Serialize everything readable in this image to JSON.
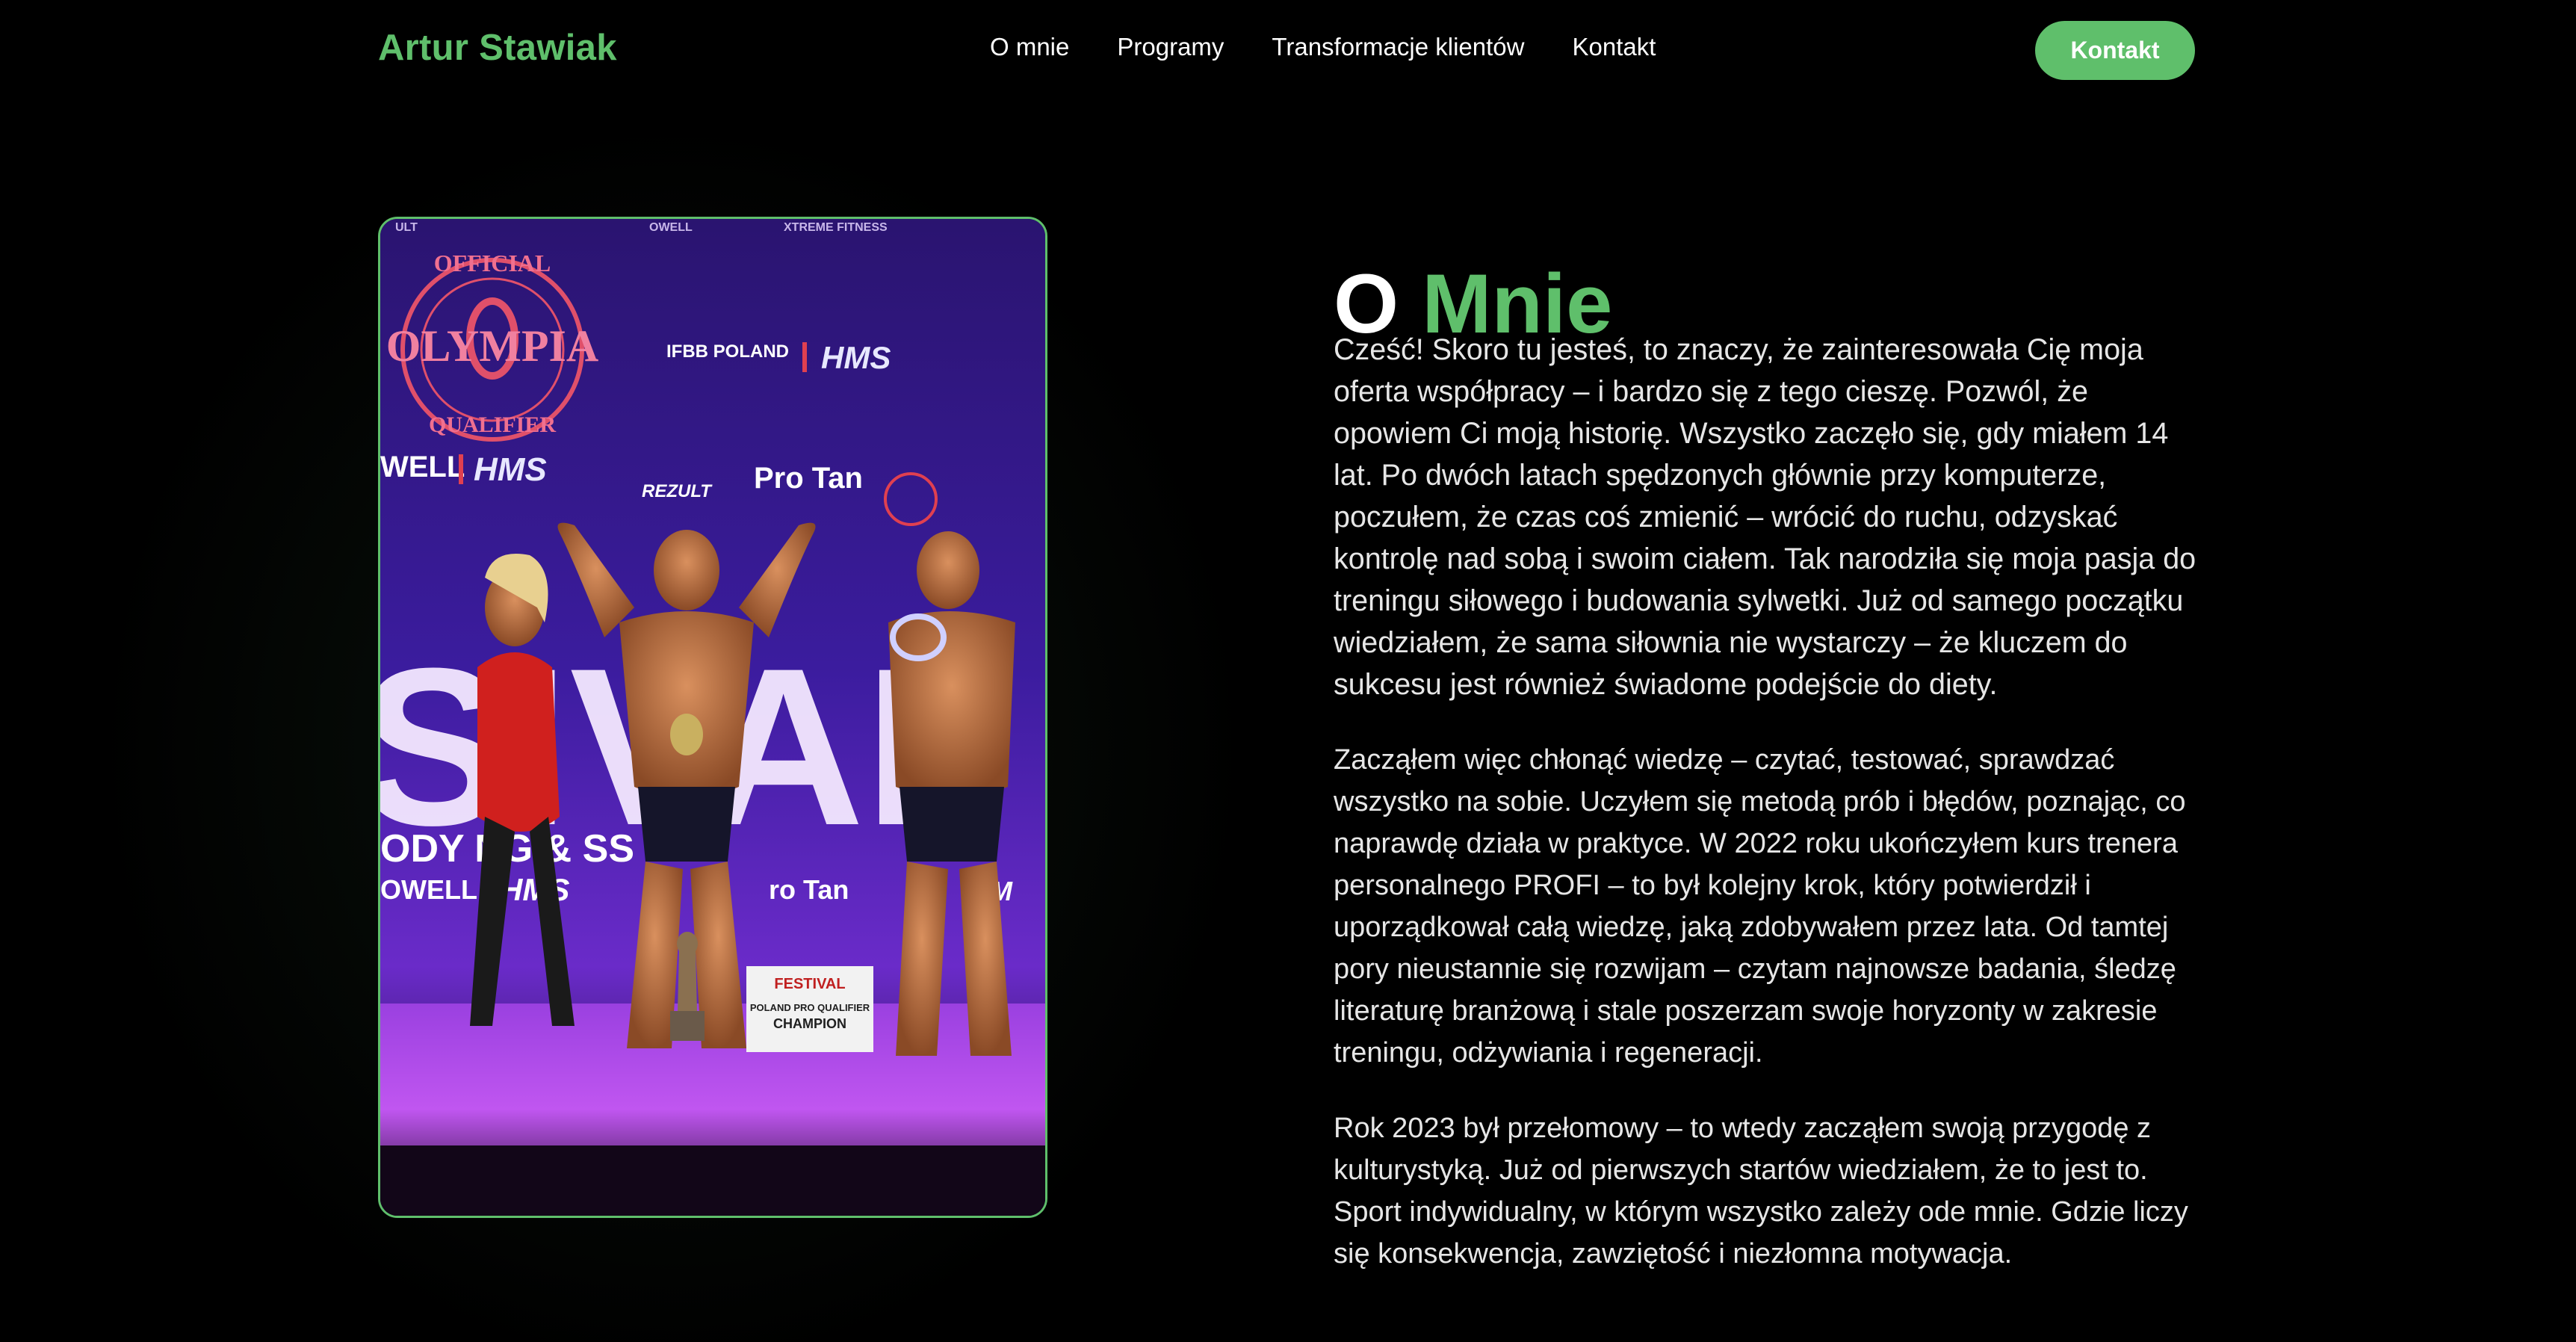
{
  "header": {
    "brand": "Artur Stawiak",
    "nav": [
      {
        "label": "O mnie"
      },
      {
        "label": "Programy"
      },
      {
        "label": "Transformacje klientów"
      },
      {
        "label": "Kontakt"
      }
    ],
    "cta_label": "Kontakt"
  },
  "photo": {
    "banner_logo_text": [
      "OFFICIAL",
      "OLYMPIA",
      "QUALIFIER"
    ],
    "sponsor_texts": [
      "IFBB POLAND",
      "HMS",
      "REZULT",
      "Pro Tan"
    ],
    "stage_text": "FESTIVAL",
    "trophy_sign": [
      "FESTIVAL",
      "POLAND PRO QUALIFIER",
      "CHAMPION"
    ]
  },
  "about": {
    "title_word1": "O",
    "title_word2": "Mnie",
    "paragraphs": [
      "Cześć! Skoro tu jesteś, to znaczy, że zainteresowała Cię moja oferta współpracy – i bardzo się z tego cieszę. Pozwól, że opowiem Ci moją historię. Wszystko zaczęło się, gdy miałem 14 lat. Po dwóch latach spędzonych głównie przy komputerze, poczułem, że czas coś zmienić – wrócić do ruchu, odzyskać kontrolę nad sobą i swoim ciałem. Tak narodziła się moja pasja do treningu siłowego i budowania sylwetki. Już od samego początku wiedziałem, że sama siłownia nie wystarczy – że kluczem do sukcesu jest również świadome podejście do diety.",
      "Zacząłem więc chłonąć wiedzę – czytać, testować, sprawdzać wszystko na sobie. Uczyłem się metodą prób i błędów, poznając, co naprawdę działa w praktyce. W 2022 roku ukończyłem kurs trenera personalnego PROFI – to był kolejny krok, który potwierdził i uporządkował całą wiedzę, jaką zdobywałem przez lata. Od tamtej pory nieustannie się rozwijam – czytam najnowsze badania, śledzę literaturę branżową i stale poszerzam swoje horyzonty w zakresie treningu, odżywiania i regeneracji.",
      "Rok 2023 był przełomowy – to wtedy zacząłem swoją przygodę z kulturystyką. Już od pierwszych startów wiedziałem, że to jest to. Sport indywidualny, w którym wszystko zależy ode mnie. Gdzie liczy się konsekwencja, zawziętość i niezłomna motywacja."
    ]
  },
  "colors": {
    "accent": "#5fbf6b",
    "background": "#000000",
    "text": "#e6e6e6"
  }
}
